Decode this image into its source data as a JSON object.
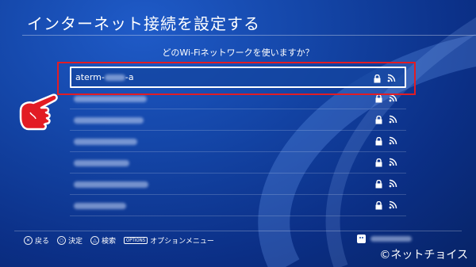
{
  "header": {
    "title": "インターネット接続を設定する"
  },
  "prompt": {
    "question": "どのWi-Fiネットワークを使いますか？"
  },
  "networks": [
    {
      "ssid_prefix": "aterm-",
      "ssid_suffix": "-a",
      "selected": true
    },
    {
      "ssid_prefix": "",
      "ssid_suffix": "",
      "selected": false
    },
    {
      "ssid_prefix": "",
      "ssid_suffix": "",
      "selected": false
    },
    {
      "ssid_prefix": "",
      "ssid_suffix": "",
      "selected": false
    },
    {
      "ssid_prefix": "",
      "ssid_suffix": "",
      "selected": false
    },
    {
      "ssid_prefix": "",
      "ssid_suffix": "",
      "selected": false
    },
    {
      "ssid_prefix": "",
      "ssid_suffix": "",
      "selected": false
    }
  ],
  "footer": {
    "back_label": "戻る",
    "ok_label": "決定",
    "search_label": "検索",
    "options_key": "OPTIONS",
    "options_label": "オプションメニュー"
  },
  "watermark": "©ネットチョイス",
  "colors": {
    "highlight": "#e21c24",
    "background": "#1446a8"
  }
}
